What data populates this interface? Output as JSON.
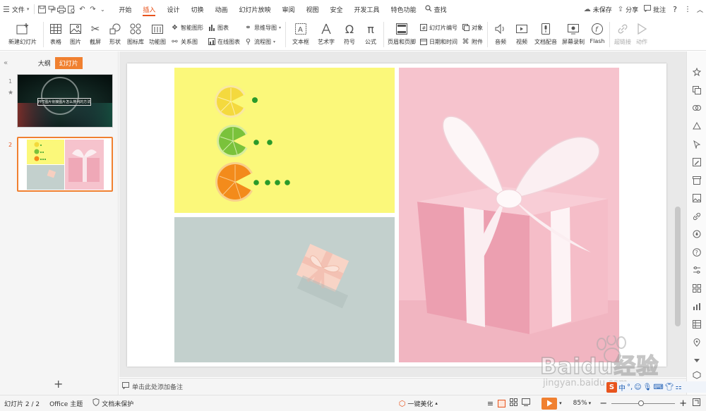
{
  "menubar": {
    "file_label": "文件",
    "tabs": [
      "开始",
      "插入",
      "设计",
      "切换",
      "动画",
      "幻灯片放映",
      "审阅",
      "视图",
      "安全",
      "开发工具",
      "特色功能"
    ],
    "active_tab": "插入",
    "search_label": "查找",
    "unsaved_label": "未保存",
    "share_label": "分享",
    "comment_label": "批注",
    "help_label": "?"
  },
  "ribbon": {
    "new_slide": "新建幻灯片",
    "table": "表格",
    "picture": "图片",
    "screenshot": "截屏",
    "shape": "形状",
    "icon_lib": "图标库",
    "func_chart": "功能图",
    "smart_art": "智能图形",
    "relation": "关系图",
    "chart": "图表",
    "online_chart": "在线图表",
    "mindmap": "思维导图",
    "flowchart": "流程图",
    "textbox": "文本框",
    "art_text": "艺术字",
    "symbol": "符号",
    "formula": "公式",
    "header_footer": "页眉和页脚",
    "slide_number": "幻灯片编号",
    "datetime": "日期和时间",
    "object": "对象",
    "attachment": "附件",
    "audio": "音频",
    "video": "视频",
    "narration": "文档配音",
    "screen_record": "屏幕录制",
    "flash": "Flash",
    "hyperlink": "超链接",
    "action": "动作"
  },
  "sidebar": {
    "outline_tab": "大纲",
    "slides_tab": "幻灯片",
    "slide1_num": "1",
    "slide2_num": "2",
    "slide1_title": "PPT图片衔接图片怎么排列的方法",
    "add_label": "+"
  },
  "notes": {
    "placeholder": "单击此处添加备注"
  },
  "status": {
    "slide_info": "幻灯片 2 / 2",
    "theme": "Office 主题",
    "protect": "文档未保护",
    "beautify": "一键美化",
    "zoom": "85%"
  },
  "watermark": {
    "main": "Baidu经验",
    "sub": "jingyan.baidu.com"
  },
  "colors": {
    "accent": "#e8541d",
    "yellow_bg": "#fbf87a",
    "pink_bg": "#f6c3cd",
    "gray_bg": "#c3d0cd"
  }
}
